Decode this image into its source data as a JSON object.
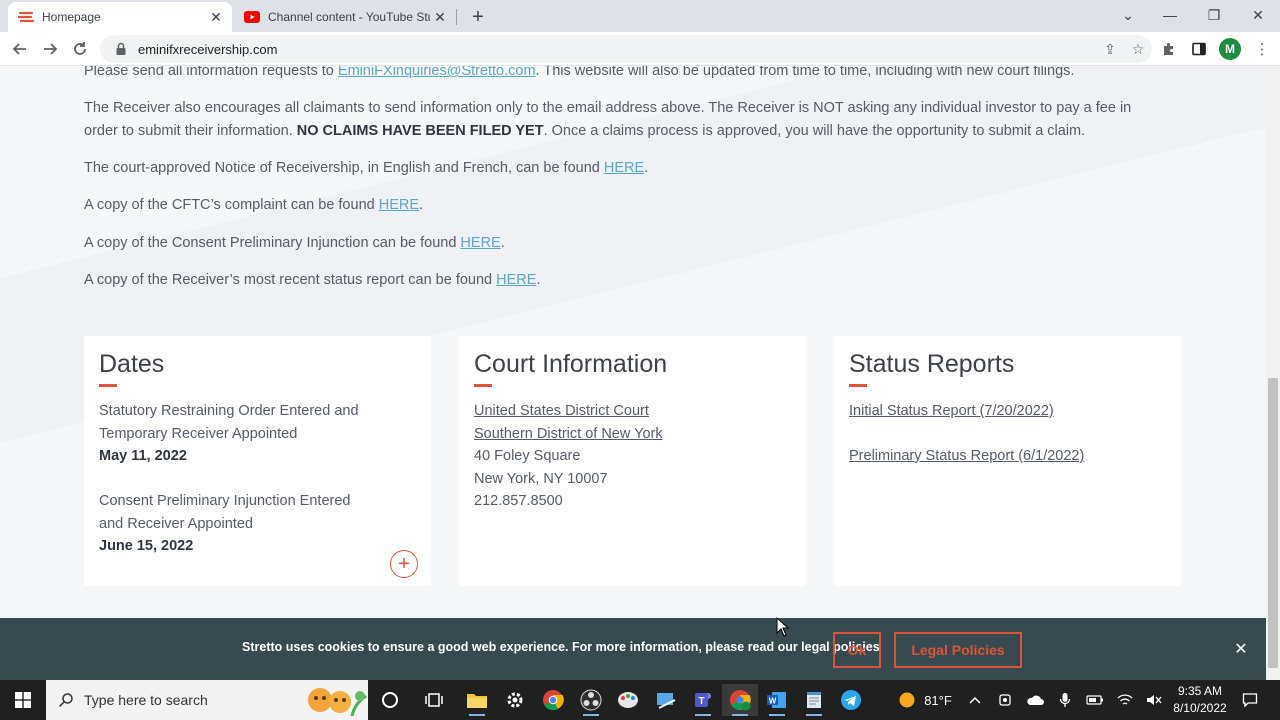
{
  "browser": {
    "tabs": [
      {
        "title": "Homepage",
        "active": true
      },
      {
        "title": "Channel content - YouTube Studio",
        "active": false
      }
    ],
    "url": "eminifxreceivership.com",
    "profile_initial": "M"
  },
  "page": {
    "paragraphs": {
      "p1_pre": "Please send all information requests to ",
      "p1_link": "EminiFXinquiries@Stretto.com",
      "p1_post": ". This website will also be updated from time to time, including with new court filings.",
      "p2_line1": "The Receiver also encourages all claimants to send information only to the email address above. The Receiver is NOT asking any individual investor to pay a fee in",
      "p2_line2_pre": "order to submit their information. ",
      "p2_bold": "NO CLAIMS HAVE BEEN FILED YET",
      "p2_line2_post": ". Once a claims process is approved, you will have the opportunity to submit a claim.",
      "p3_text": "The court-approved Notice of Receivership, in English and French, can be found ",
      "p4_text": "A copy of the CFTC’s complaint can be found ",
      "p5_text": "A copy of the Consent Preliminary Injunction can be found ",
      "p6_text": "A copy of the Receiver’s most recent status report can be found ",
      "here_link": "HERE",
      "period": "."
    },
    "dates_card": {
      "title": "Dates",
      "item1_line1": "Statutory Restraining Order Entered and",
      "item1_line2": "Temporary Receiver Appointed",
      "item1_date": "May 11, 2022",
      "item2_line1": "Consent Preliminary Injunction Entered",
      "item2_line2": "and Receiver Appointed",
      "item2_date": "June 15, 2022",
      "expand_symbol": "+"
    },
    "court_card": {
      "title": "Court Information",
      "link1": "United States District Court",
      "link2": "Southern District of New York",
      "address1": "40 Foley Square",
      "address2": "New York, NY 10007",
      "phone": "212.857.8500"
    },
    "status_card": {
      "title": "Status Reports",
      "report1": "Initial Status Report (7/20/2022)",
      "report2": "Preliminary Status Report (6/1/2022)"
    }
  },
  "cookie_banner": {
    "text": "Stretto uses cookies to ensure a good web experience. For more information, please read our legal policies",
    "ok_label": "Ok",
    "legal_label": "Legal Policies"
  },
  "taskbar": {
    "search_placeholder": "Type here to search",
    "temperature": "81°F",
    "time": "9:35 AM",
    "date": "8/10/2022"
  },
  "colors": {
    "accent_red": "#e0533b",
    "link_blue": "#5aa7c9",
    "cookie_bg": "#374a4f"
  }
}
